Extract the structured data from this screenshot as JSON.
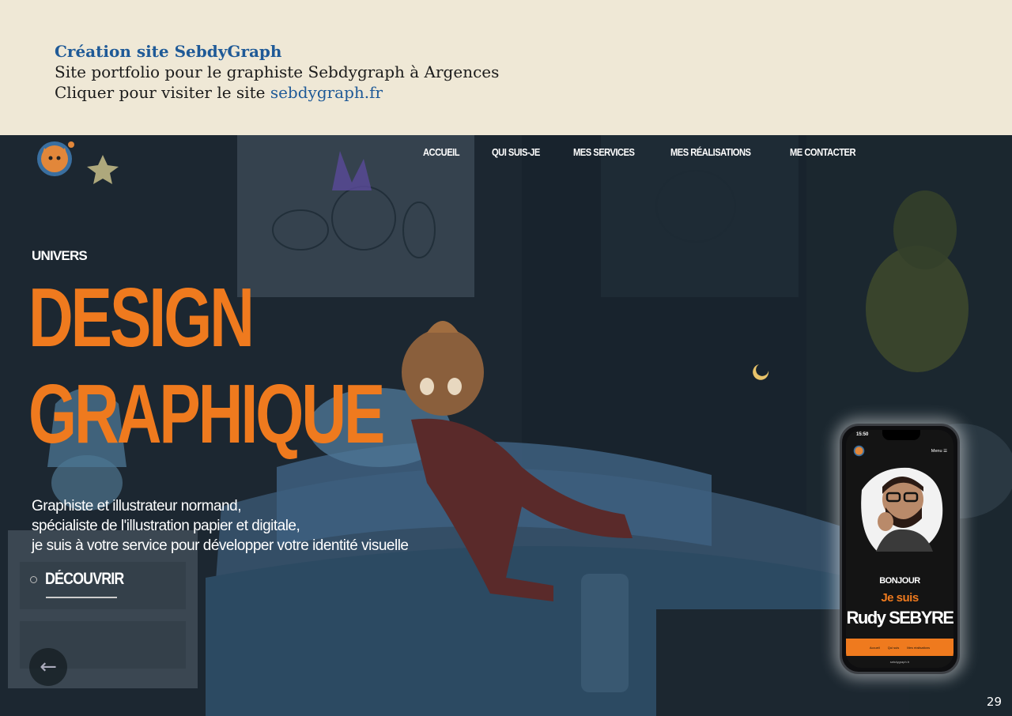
{
  "caption": {
    "title": "Création site SebdyGraph",
    "line2": "Site portfolio pour le graphiste Sebdygraph à Argences",
    "line3_prefix": "Cliquer pour visiter le site ",
    "link_text": "sebdygraph.fr"
  },
  "website": {
    "nav": [
      "ACCUEIL",
      "QUI SUIS-JE",
      "MES SERVICES",
      "MES RÉALISATIONS",
      "ME CONTACTER"
    ],
    "eyebrow": "UNIVERS",
    "headline_1": "DESIGN",
    "headline_2": "GRAPHIQUE",
    "description": [
      "Graphiste et illustrateur normand,",
      "spécialiste de l'illustration papier et digitale,",
      "je suis à votre service pour développer votre identité visuelle"
    ],
    "cta": "DÉCOUVRIR",
    "back_icon": "arrow-left-icon",
    "accent_color": "#ef7a1e"
  },
  "phone": {
    "time": "15:50",
    "menu": "Menu ☰",
    "greeting": "BONJOUR",
    "intro": "Je suis",
    "name": "Rudy SEBYRE",
    "bar_items": [
      "Accueil",
      "Qui suis",
      "Mes réalisations"
    ],
    "url": "sebdygraph.fr"
  },
  "page_number": "29"
}
